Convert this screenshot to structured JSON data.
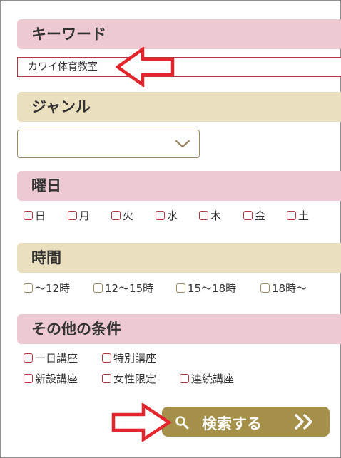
{
  "keyword": {
    "heading": "キーワード",
    "value": "カワイ体育教室"
  },
  "genre": {
    "heading": "ジャンル",
    "selected": ""
  },
  "weekday": {
    "heading": "曜日",
    "options": [
      "日",
      "月",
      "火",
      "水",
      "木",
      "金",
      "土"
    ]
  },
  "time": {
    "heading": "時間",
    "options": [
      "〜12時",
      "12〜15時",
      "15〜18時",
      "18時〜"
    ]
  },
  "conditions": {
    "heading": "その他の条件",
    "options": [
      "一日講座",
      "特別講座",
      "新設講座",
      "女性限定",
      "連続講座"
    ]
  },
  "search": {
    "label": "検索する"
  },
  "colors": {
    "pink_header": "#edc9d1",
    "beige_header": "#eadfbe",
    "button": "#a59049",
    "annotation_arrow": "#e3262d"
  },
  "icons": [
    "chevron-down-icon",
    "search-icon",
    "double-chevron-right-icon",
    "arrow-left-icon",
    "arrow-right-icon"
  ]
}
